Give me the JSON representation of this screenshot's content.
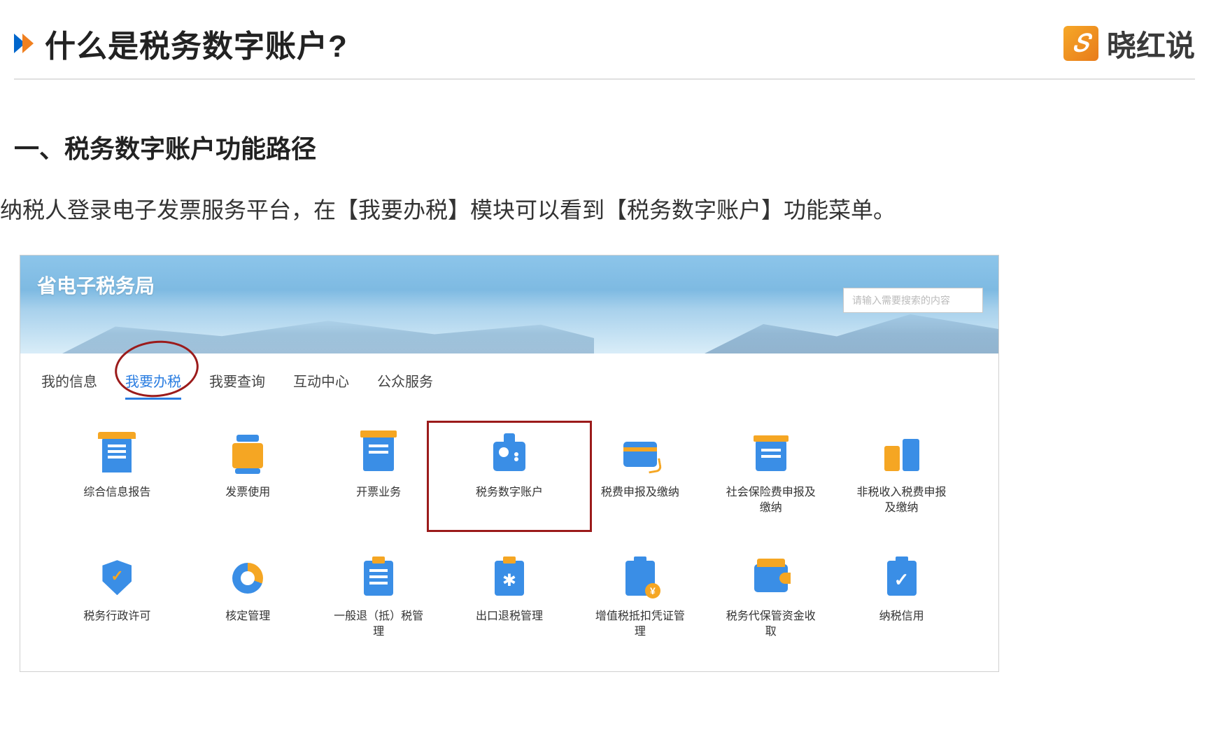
{
  "header": {
    "title": "什么是税务数字账户?",
    "brand": "晓红说"
  },
  "section": {
    "heading": "一、税务数字账户功能路径",
    "body": "纳税人登录电子发票服务平台，在【我要办税】模块可以看到【税务数字账户】功能菜单。"
  },
  "portal": {
    "title": "省电子税务局",
    "search_placeholder": "请输入需要搜索的内容",
    "tabs": [
      "我的信息",
      "我要办税",
      "我要查询",
      "互动中心",
      "公众服务"
    ],
    "active_tab_index": 1,
    "highlighted_tile_index": 3,
    "tiles": [
      {
        "label": "综合信息报告",
        "icon": "doc"
      },
      {
        "label": "发票使用",
        "icon": "stack"
      },
      {
        "label": "开票业务",
        "icon": "receipt"
      },
      {
        "label": "税务数字账户",
        "icon": "id"
      },
      {
        "label": "税费申报及缴纳",
        "icon": "card"
      },
      {
        "label": "社会保险费申报及缴纳",
        "icon": "cal"
      },
      {
        "label": "非税收入税费申报及缴纳",
        "icon": "split"
      },
      {
        "label": "税务行政许可",
        "icon": "shield"
      },
      {
        "label": "核定管理",
        "icon": "pie"
      },
      {
        "label": "一般退（抵）税管理",
        "icon": "list"
      },
      {
        "label": "出口退税管理",
        "icon": "gear"
      },
      {
        "label": "增值税抵扣凭证管理",
        "icon": "coin"
      },
      {
        "label": "税务代保管资金收取",
        "icon": "wallet"
      },
      {
        "label": "纳税信用",
        "icon": "check"
      }
    ]
  }
}
